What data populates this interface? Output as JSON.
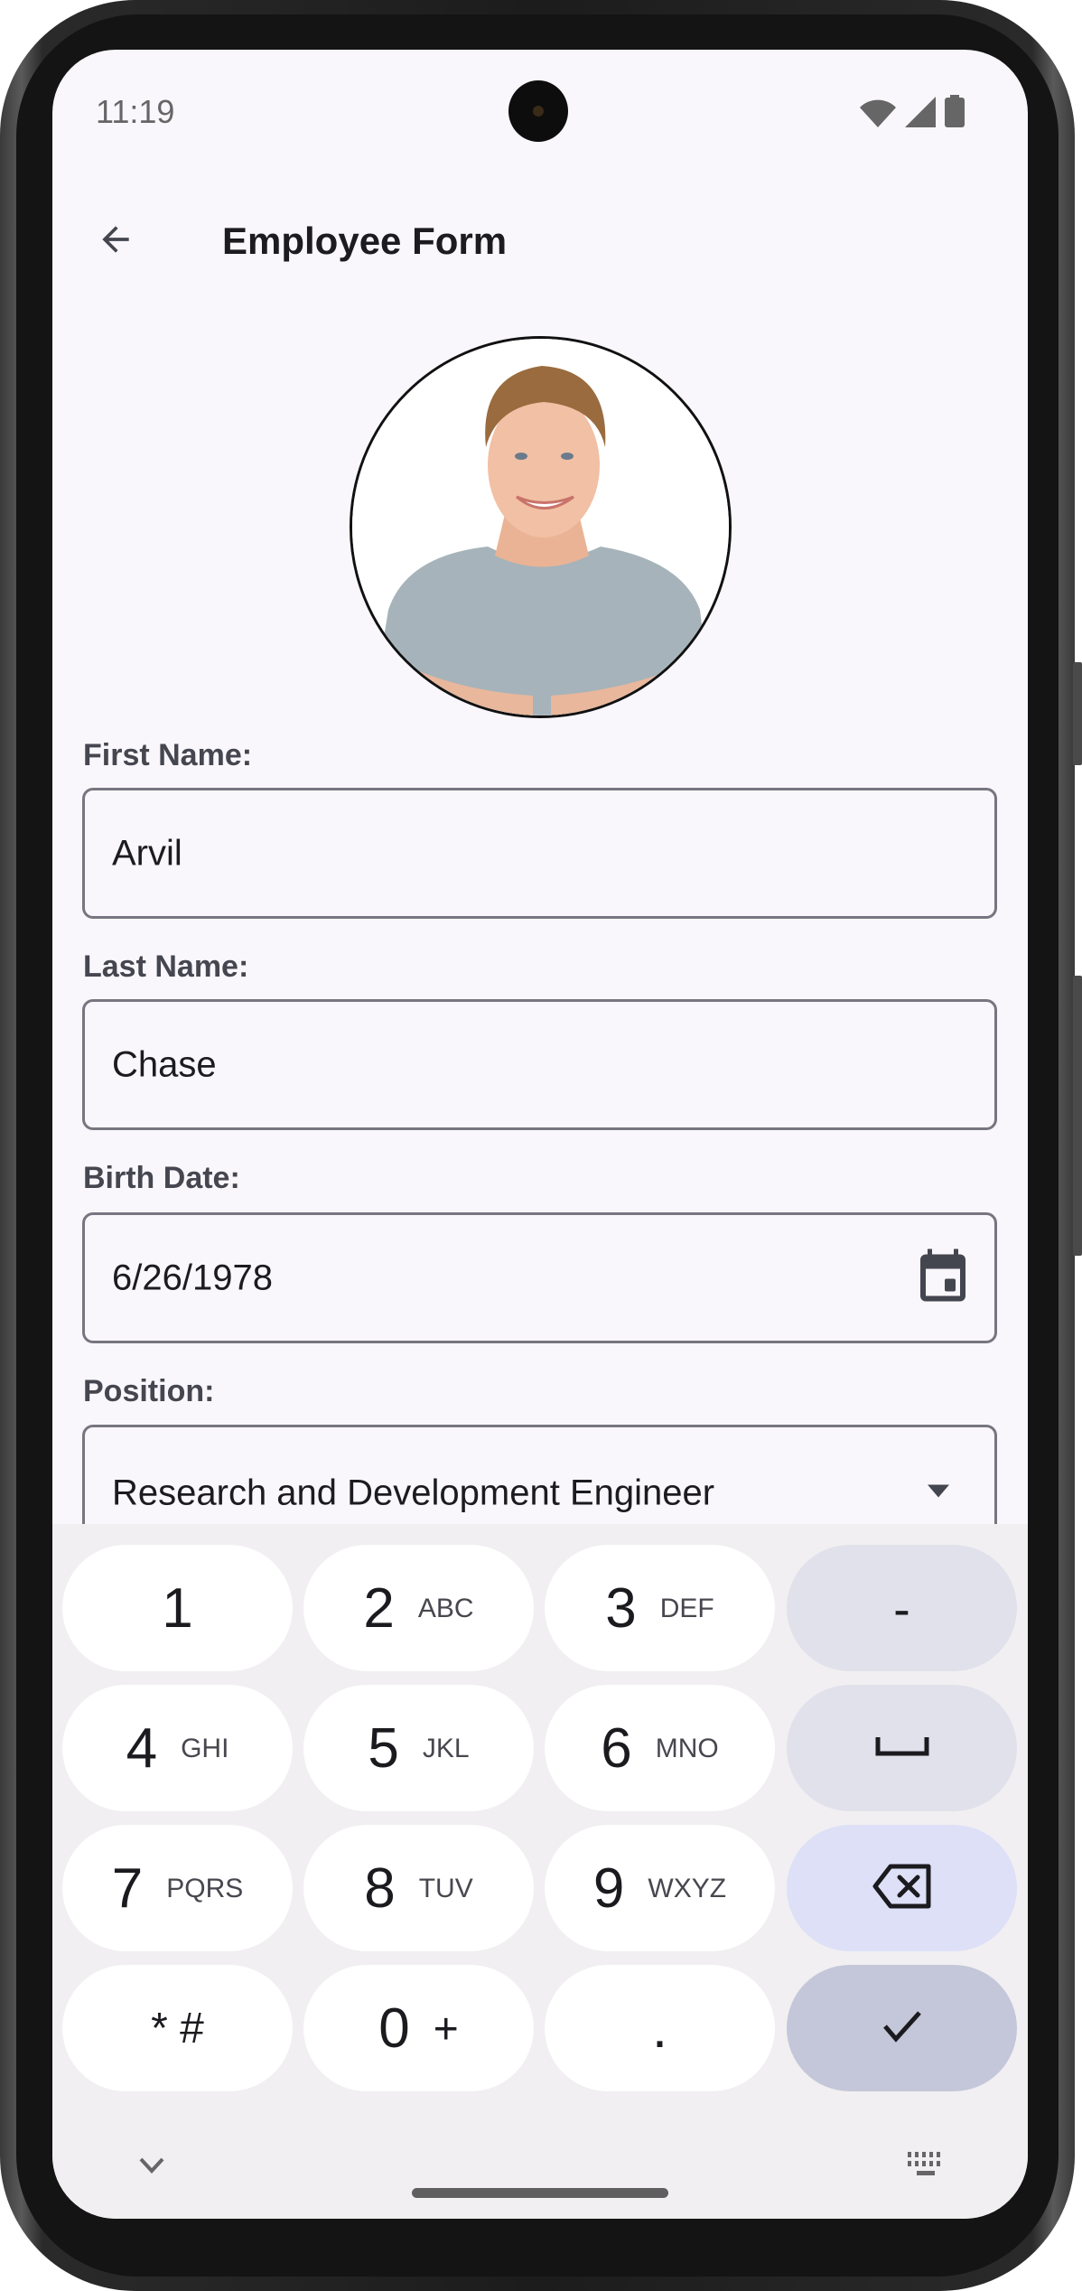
{
  "status_bar": {
    "time": "11:19",
    "icons": [
      "wifi-icon",
      "cell-signal-icon",
      "battery-icon"
    ]
  },
  "app_bar": {
    "back_icon": "arrow-back-icon",
    "title": "Employee Form"
  },
  "avatar": {
    "alt": "Employee photo: smiling man with short light-brown hair in a gray t-shirt"
  },
  "form": {
    "fields": [
      {
        "label": "First Name:",
        "value": "Arvil"
      },
      {
        "label": "Last Name:",
        "value": "Chase"
      },
      {
        "label": "Birth Date:",
        "value": "6/26/1978",
        "icon": "calendar-icon"
      },
      {
        "label": "Position:",
        "value": "Research and Development Engineer",
        "icon": "dropdown-arrow-icon"
      }
    ]
  },
  "keyboard": {
    "rows": [
      [
        {
          "digit": "1",
          "letters": ""
        },
        {
          "digit": "2",
          "letters": "ABC"
        },
        {
          "digit": "3",
          "letters": "DEF"
        },
        {
          "digit": "-",
          "letters": "",
          "type": "func"
        }
      ],
      [
        {
          "digit": "4",
          "letters": "GHI"
        },
        {
          "digit": "5",
          "letters": "JKL"
        },
        {
          "digit": "6",
          "letters": "MNO"
        },
        {
          "digit": "",
          "letters": "",
          "type": "func",
          "icon": "space-icon"
        }
      ],
      [
        {
          "digit": "7",
          "letters": "PQRS"
        },
        {
          "digit": "8",
          "letters": "TUV"
        },
        {
          "digit": "9",
          "letters": "WXYZ"
        },
        {
          "digit": "",
          "letters": "",
          "type": "del",
          "icon": "backspace-icon"
        }
      ],
      [
        {
          "digit": "* #",
          "letters": ""
        },
        {
          "digit": "0",
          "letters": "+"
        },
        {
          "digit": ".",
          "letters": ""
        },
        {
          "digit": "",
          "letters": "",
          "type": "done",
          "icon": "check-icon"
        }
      ]
    ],
    "bottom_left_icon": "chevron-down-icon",
    "bottom_right_icon": "keyboard-switch-icon"
  },
  "colors": {
    "screen_bg": "#f9f7fc",
    "field_border": "#777680",
    "keyboard_bg": "#f1eff1",
    "key_func": "#e1e1ec",
    "key_backspace": "#dde0f7",
    "key_done": "#c4c7d9"
  }
}
